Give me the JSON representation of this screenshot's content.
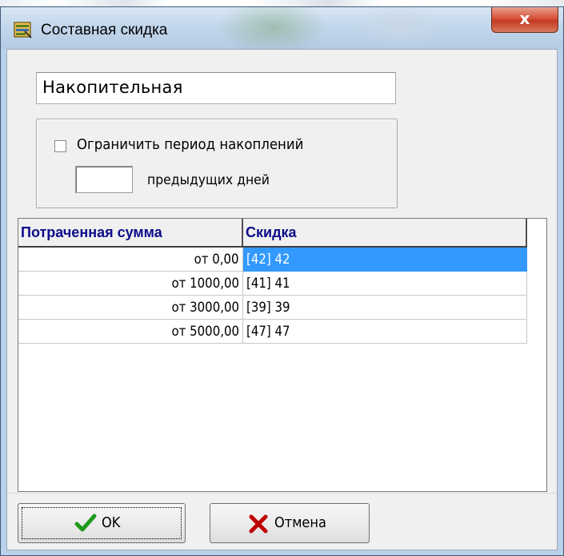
{
  "window": {
    "title": "Составная скидка",
    "close_symbol": "x",
    "app_icon": "discount-card-icon"
  },
  "form": {
    "name_value": "Накопительная",
    "limit_checkbox_label": "Ограничить период накоплений",
    "limit_checked": false,
    "days_value": "",
    "days_label": "предыдущих дней"
  },
  "table": {
    "columns": [
      "Потраченная сумма",
      "Скидка"
    ],
    "rows": [
      {
        "amount": "от 0,00",
        "discount": "[42] 42",
        "selected": true
      },
      {
        "amount": "от 1000,00",
        "discount": "[41] 41",
        "selected": false
      },
      {
        "amount": "от 3000,00",
        "discount": "[39] 39",
        "selected": false
      },
      {
        "amount": "от 5000,00",
        "discount": "[47] 47",
        "selected": false
      }
    ]
  },
  "buttons": {
    "ok_label": "OK",
    "ok_icon": "checkmark-icon",
    "cancel_label": "Отмена",
    "cancel_icon": "cross-icon"
  },
  "colors": {
    "selection": "#3399ff",
    "header_text": "#0b0b8a",
    "ok_icon": "#1f9a1f",
    "cancel_icon": "#c00000"
  }
}
